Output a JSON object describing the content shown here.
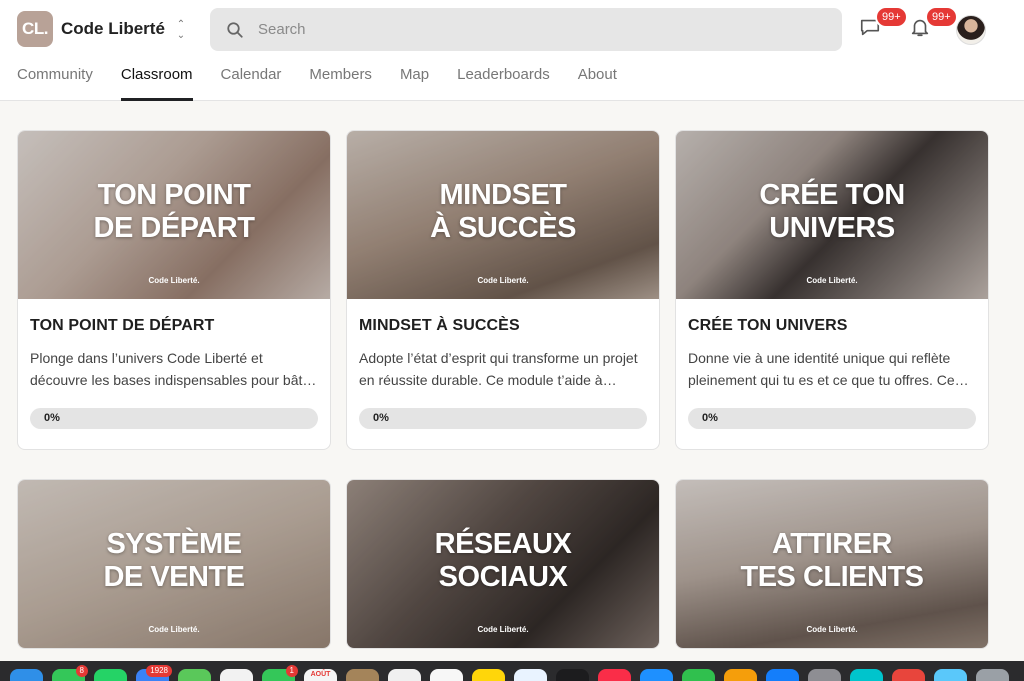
{
  "header": {
    "logo_text": "CL.",
    "brand_name": "Code Liberté",
    "search_placeholder": "Search",
    "chat_badge": "99+",
    "notifications_badge": "99+"
  },
  "tabs": [
    {
      "label": "Community"
    },
    {
      "label": "Classroom"
    },
    {
      "label": "Calendar"
    },
    {
      "label": "Members"
    },
    {
      "label": "Map"
    },
    {
      "label": "Leaderboards"
    },
    {
      "label": "About"
    }
  ],
  "active_tab": "Classroom",
  "courses": [
    {
      "cover_line1": "TON POINT",
      "cover_line2": "DE DÉPART",
      "cover_brand": "Code Liberté.",
      "title": "TON POINT DE DÉPART",
      "description": "Plonge dans l’univers Code Liberté et découvre les bases indispensables pour bât…",
      "progress_label": "0%",
      "progress": 0
    },
    {
      "cover_line1": "MINDSET",
      "cover_line2": "À SUCCÈS",
      "cover_brand": "Code Liberté.",
      "title": "MINDSET À SUCCÈS",
      "description": "Adopte l’état d’esprit qui transforme un projet en réussite durable. Ce module t’aide à…",
      "progress_label": "0%",
      "progress": 0
    },
    {
      "cover_line1": "CRÉE TON",
      "cover_line2": "UNIVERS",
      "cover_brand": "Code Liberté.",
      "title": "CRÉE TON UNIVERS",
      "description": "Donne vie à une identité unique qui reflète pleinement qui tu es et ce que tu offres. Ce…",
      "progress_label": "0%",
      "progress": 0
    },
    {
      "cover_line1": "SYSTÈME",
      "cover_line2": "DE VENTE",
      "cover_brand": "Code Liberté."
    },
    {
      "cover_line1": "RÉSEAUX",
      "cover_line2": "SOCIAUX",
      "cover_brand": "Code Liberté."
    },
    {
      "cover_line1": "ATTIRER",
      "cover_line2": "TES CLIENTS",
      "cover_brand": "Code Liberté."
    }
  ],
  "dock": {
    "apps": [
      {
        "icon": "safari-icon",
        "color": "#2f8fe8"
      },
      {
        "icon": "messages-icon",
        "color": "#34c759",
        "badge": "8"
      },
      {
        "icon": "whatsapp-icon",
        "color": "#25d366"
      },
      {
        "icon": "mail-icon",
        "color": "#3b82f6",
        "badge": "1928"
      },
      {
        "icon": "maps-icon",
        "color": "#5ac85a"
      },
      {
        "icon": "photos-icon",
        "color": "#f2f2f2"
      },
      {
        "icon": "facetime-icon",
        "color": "#34c759",
        "badge": "1"
      },
      {
        "icon": "calendar-icon",
        "color": "#f5f5f5",
        "label": "AOÛT"
      },
      {
        "icon": "notes-icon",
        "color": "#a4845a"
      },
      {
        "icon": "contacts-icon",
        "color": "#f0f0f0"
      },
      {
        "icon": "reminders-icon",
        "color": "#f7f7f7"
      },
      {
        "icon": "notes-yellow-icon",
        "color": "#ffd60a"
      },
      {
        "icon": "freeform-icon",
        "color": "#e9f3ff"
      },
      {
        "icon": "tv-icon",
        "color": "#1c1c1e"
      },
      {
        "icon": "music-icon",
        "color": "#fa2d48"
      },
      {
        "icon": "appstore-icon",
        "color": "#1e90ff"
      },
      {
        "icon": "numbers-icon",
        "color": "#30c04e"
      },
      {
        "icon": "keynote-icon",
        "color": "#f59e0b"
      },
      {
        "icon": "xcode-icon",
        "color": "#147efb"
      },
      {
        "icon": "settings-icon",
        "color": "#8e8e93"
      },
      {
        "icon": "canva-icon",
        "color": "#00c4cc"
      },
      {
        "icon": "chrome-icon",
        "color": "#e8453c"
      },
      {
        "icon": "finder-icon",
        "color": "#5ac8fa"
      },
      {
        "icon": "trash-icon",
        "color": "#9aa0a6"
      }
    ]
  }
}
